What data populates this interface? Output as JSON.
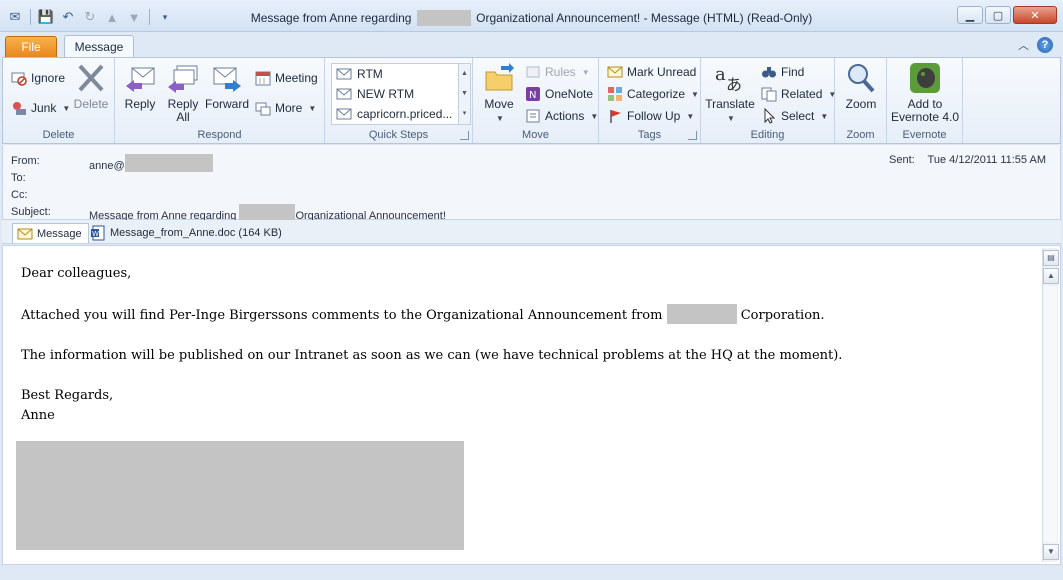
{
  "window": {
    "title_prefix": "Message from Anne regarding",
    "title_suffix": "Organizational Announcement!  -  Message (HTML) (Read-Only)"
  },
  "tabs": {
    "file": "File",
    "message": "Message"
  },
  "ribbon": {
    "delete": {
      "label": "Delete",
      "ignore": "Ignore",
      "junk": "Junk",
      "delete_btn": "Delete"
    },
    "respond": {
      "label": "Respond",
      "reply": "Reply",
      "reply_all_1": "Reply",
      "reply_all_2": "All",
      "forward": "Forward",
      "meeting": "Meeting",
      "more": "More"
    },
    "quick_steps": {
      "label": "Quick Steps",
      "items": [
        "RTM",
        "NEW RTM",
        "capricorn.priced..."
      ]
    },
    "move": {
      "label": "Move",
      "move_btn": "Move",
      "rules": "Rules",
      "onenote": "OneNote",
      "actions": "Actions"
    },
    "tags": {
      "label": "Tags",
      "mark_unread": "Mark Unread",
      "categorize": "Categorize",
      "follow_up": "Follow Up"
    },
    "editing": {
      "label": "Editing",
      "translate": "Translate",
      "find": "Find",
      "related": "Related",
      "select": "Select"
    },
    "zoom": {
      "label": "Zoom",
      "zoom_btn": "Zoom"
    },
    "evernote": {
      "label": "Evernote",
      "add_1": "Add to",
      "add_2": "Evernote 4.0"
    }
  },
  "header": {
    "from_label": "From:",
    "from_value": "anne@",
    "to_label": "To:",
    "cc_label": "Cc:",
    "subject_label": "Subject:",
    "subject_prefix": "Message from Anne regarding",
    "subject_suffix": "Organizational Announcement!",
    "sent_label": "Sent:",
    "sent_value": "Tue 4/12/2011 11:55 AM"
  },
  "attachments": {
    "message_tab": "Message",
    "file": "Message_from_Anne.doc (164 KB)"
  },
  "body": {
    "greeting": "Dear colleagues,",
    "line1_prefix": "Attached you will find Per-Inge Birgerssons comments to the Organizational Announcement from",
    "line1_suffix": "Corporation.",
    "line2": "The information will be published on our Intranet as soon as we can (we have technical problems at the HQ at the moment).",
    "closing": "Best Regards,",
    "signature": "Anne"
  }
}
